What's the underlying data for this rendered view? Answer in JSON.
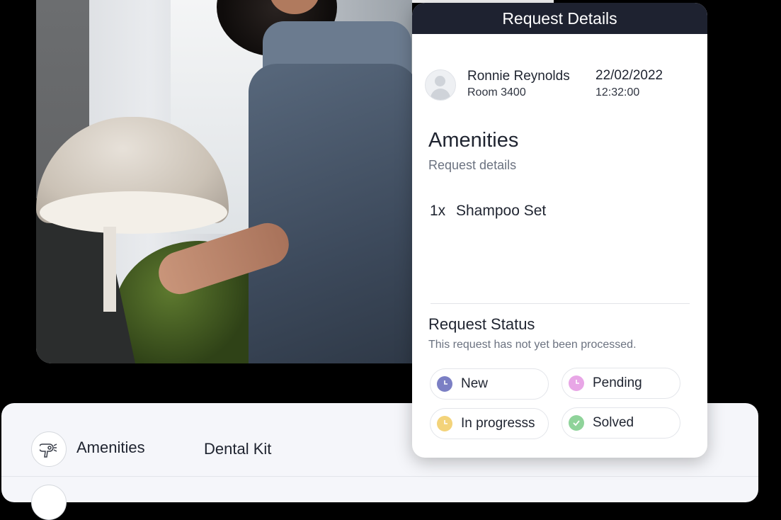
{
  "card": {
    "title": "Request Details",
    "guest": {
      "name": "Ronnie Reynolds",
      "room": "Room 3400"
    },
    "timestamp": {
      "date": "22/02/2022",
      "time": "12:32:00"
    },
    "category": "Amenities",
    "subtitle": "Request details",
    "items": [
      {
        "qty": "1x",
        "name": "Shampoo Set"
      }
    ],
    "status": {
      "title": "Request Status",
      "note": "This request has not yet been processed.",
      "options": [
        {
          "label": "New",
          "icon": "clock-icon",
          "color": "#7b7fc4"
        },
        {
          "label": "Pending",
          "icon": "clock-icon",
          "color": "#e8a6e6"
        },
        {
          "label": "In progresss",
          "icon": "clock-icon",
          "color": "#f3d37a"
        },
        {
          "label": "Solved",
          "icon": "check-icon",
          "color": "#8fd39a"
        }
      ]
    }
  },
  "list": {
    "rows": [
      {
        "icon": "hair-dryer-icon",
        "category": "Amenities",
        "item": "Dental Kit"
      }
    ]
  }
}
